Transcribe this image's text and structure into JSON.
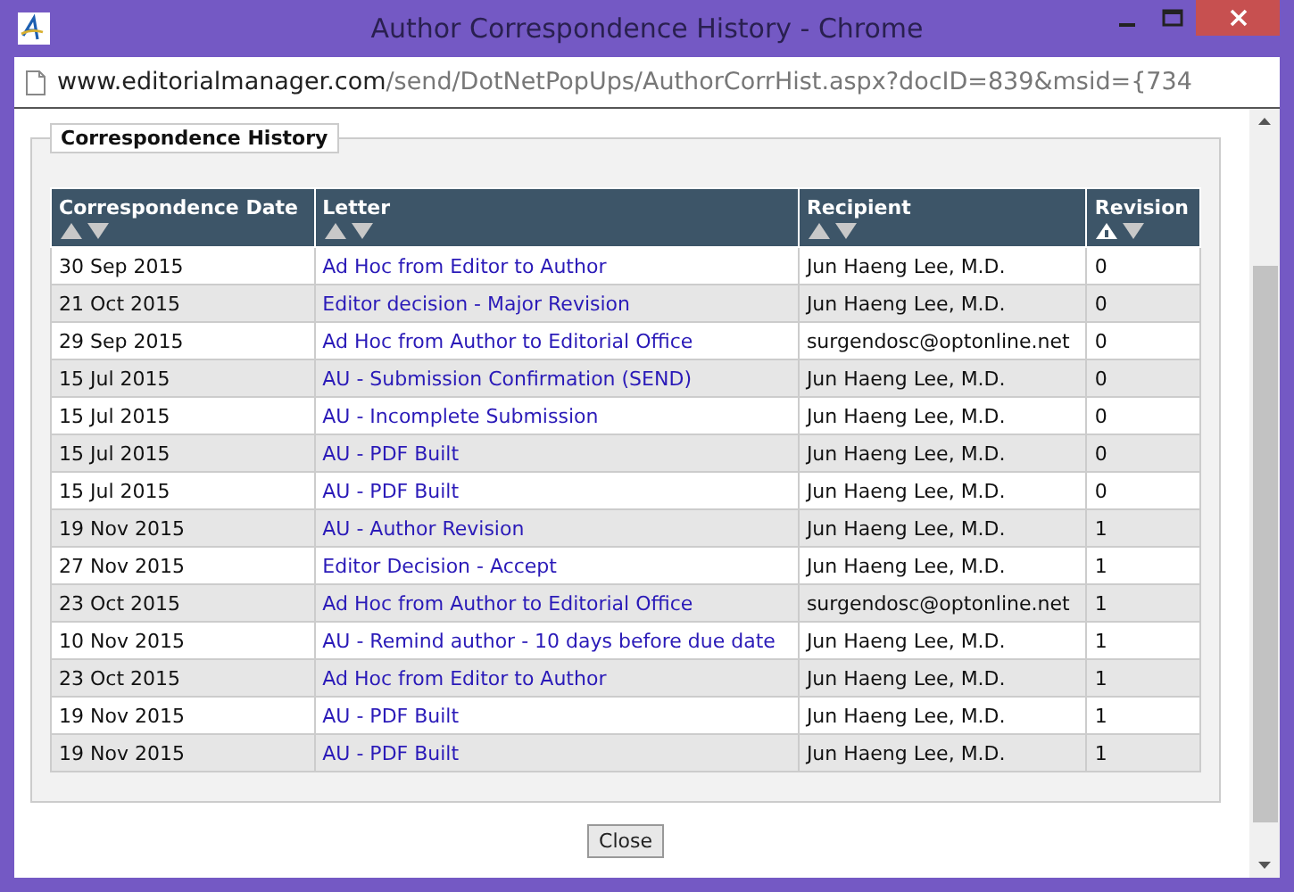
{
  "window": {
    "title": "Author Correspondence History - Chrome"
  },
  "address_bar": {
    "host": "www.editorialmanager.com",
    "path": "/send/DotNetPopUps/AuthorCorrHist.aspx?docID=839&msid={734"
  },
  "section": {
    "legend": "Correspondence History"
  },
  "table": {
    "columns": [
      {
        "label": "Correspondence Date",
        "sorted": false
      },
      {
        "label": "Letter",
        "sorted": false
      },
      {
        "label": "Recipient",
        "sorted": false
      },
      {
        "label": "Revision",
        "sorted": true
      }
    ],
    "rows": [
      {
        "date": "30 Sep 2015",
        "letter": "Ad Hoc from Editor to Author",
        "recipient": "Jun Haeng Lee, M.D.",
        "revision": "0"
      },
      {
        "date": "21 Oct 2015",
        "letter": "Editor decision - Major Revision",
        "recipient": "Jun Haeng Lee, M.D.",
        "revision": "0"
      },
      {
        "date": "29 Sep 2015",
        "letter": "Ad Hoc from Author to Editorial Office",
        "recipient": "surgendosc@optonline.net",
        "revision": "0"
      },
      {
        "date": "15 Jul 2015",
        "letter": "AU - Submission Confirmation (SEND)",
        "recipient": "Jun Haeng Lee, M.D.",
        "revision": "0"
      },
      {
        "date": "15 Jul 2015",
        "letter": "AU - Incomplete Submission",
        "recipient": "Jun Haeng Lee, M.D.",
        "revision": "0"
      },
      {
        "date": "15 Jul 2015",
        "letter": "AU - PDF Built",
        "recipient": "Jun Haeng Lee, M.D.",
        "revision": "0"
      },
      {
        "date": "15 Jul 2015",
        "letter": "AU - PDF Built",
        "recipient": "Jun Haeng Lee, M.D.",
        "revision": "0"
      },
      {
        "date": "19 Nov 2015",
        "letter": "AU - Author Revision",
        "recipient": "Jun Haeng Lee, M.D.",
        "revision": "1"
      },
      {
        "date": "27 Nov 2015",
        "letter": "Editor Decision - Accept",
        "recipient": "Jun Haeng Lee, M.D.",
        "revision": "1"
      },
      {
        "date": "23 Oct 2015",
        "letter": "Ad Hoc from Author to Editorial Office",
        "recipient": "surgendosc@optonline.net",
        "revision": "1"
      },
      {
        "date": "10 Nov 2015",
        "letter": "AU - Remind author - 10 days before due date",
        "recipient": "Jun Haeng Lee, M.D.",
        "revision": "1"
      },
      {
        "date": "23 Oct 2015",
        "letter": "Ad Hoc from Editor to Author",
        "recipient": "Jun Haeng Lee, M.D.",
        "revision": "1"
      },
      {
        "date": "19 Nov 2015",
        "letter": "AU - PDF Built",
        "recipient": "Jun Haeng Lee, M.D.",
        "revision": "1"
      },
      {
        "date": "19 Nov 2015",
        "letter": "AU - PDF Built",
        "recipient": "Jun Haeng Lee, M.D.",
        "revision": "1"
      }
    ]
  },
  "buttons": [
    {
      "label": "Close"
    }
  ]
}
